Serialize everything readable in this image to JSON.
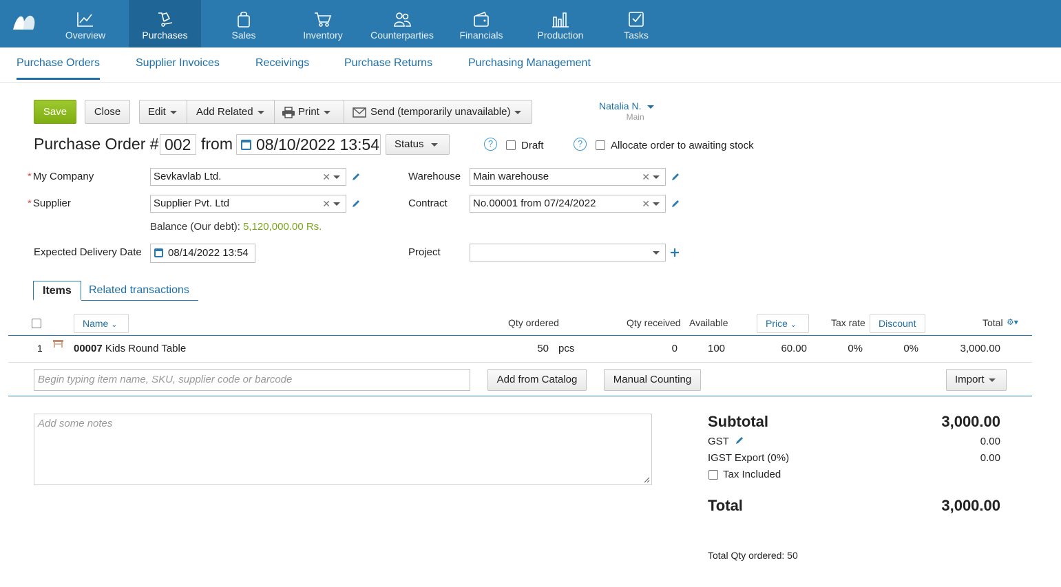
{
  "nav": {
    "items": [
      {
        "label": "Overview",
        "icon": "chart-line-icon"
      },
      {
        "label": "Purchases",
        "icon": "purchases-icon",
        "active": true
      },
      {
        "label": "Sales",
        "icon": "shopping-bag-icon"
      },
      {
        "label": "Inventory",
        "icon": "cart-icon"
      },
      {
        "label": "Counterparties",
        "icon": "people-icon"
      },
      {
        "label": "Financials",
        "icon": "wallet-icon"
      },
      {
        "label": "Production",
        "icon": "factory-icon"
      },
      {
        "label": "Tasks",
        "icon": "checkbox-icon"
      }
    ]
  },
  "subnav": {
    "items": [
      "Purchase Orders",
      "Supplier Invoices",
      "Receivings",
      "Purchase Returns",
      "Purchasing Management"
    ]
  },
  "toolbar": {
    "save": "Save",
    "close": "Close",
    "edit": "Edit",
    "add_related": "Add Related",
    "print": "Print",
    "send": "Send (temporarily unavailable)"
  },
  "user": {
    "name": "Natalia N.",
    "role": "Main"
  },
  "header": {
    "title": "Purchase Order #",
    "number": "002",
    "from": "from",
    "date": "08/10/2022 13:54",
    "status": "Status",
    "draft": "Draft",
    "allocate": "Allocate order to awaiting stock"
  },
  "form": {
    "my_company_label": "My Company",
    "my_company": "Sevkavlab Ltd.",
    "supplier_label": "Supplier",
    "supplier": "Supplier Pvt. Ltd",
    "balance_label": "Balance (Our debt):",
    "balance_value": "5,120,000.00 Rs.",
    "delivery_label": "Expected Delivery Date",
    "delivery_date": "08/14/2022 13:54",
    "warehouse_label": "Warehouse",
    "warehouse": "Main warehouse",
    "contract_label": "Contract",
    "contract": "No.00001 from 07/24/2022",
    "project_label": "Project",
    "project": ""
  },
  "tabs": {
    "items": "Items",
    "related": "Related transactions"
  },
  "table": {
    "headers": {
      "name": "Name",
      "qty_ordered": "Qty ordered",
      "qty_received": "Qty received",
      "available": "Available",
      "price": "Price",
      "tax_rate": "Tax rate",
      "discount": "Discount",
      "total": "Total"
    },
    "rows": [
      {
        "num": "1",
        "sku": "00007",
        "name": "Kids Round Table",
        "qty": "50",
        "unit": "pcs",
        "received": "0",
        "available": "100",
        "price": "60.00",
        "tax": "0%",
        "discount": "0%",
        "total": "3,000.00"
      }
    ],
    "search_placeholder": "Begin typing item name, SKU, supplier code or barcode",
    "add_catalog": "Add from Catalog",
    "manual_counting": "Manual Counting",
    "import": "Import"
  },
  "notes": {
    "placeholder": "Add some notes"
  },
  "summary": {
    "subtotal_label": "Subtotal",
    "subtotal": "3,000.00",
    "gst_label": "GST",
    "gst": "0.00",
    "igst_label": "IGST Export (0%)",
    "igst": "0.00",
    "tax_included": "Tax Included",
    "total_label": "Total",
    "total": "3,000.00",
    "total_qty": "Total Qty ordered: 50"
  },
  "colors": {
    "nav_bg": "#2a7ab0",
    "nav_active": "#1f6697",
    "link": "#1f6fa8",
    "save": "#8cbd1f",
    "balance": "#7aa51c"
  }
}
